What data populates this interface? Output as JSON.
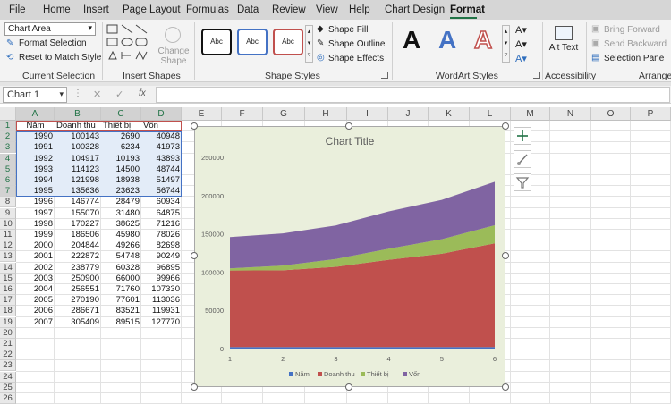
{
  "ribbon_tabs": [
    "File",
    "Home",
    "Insert",
    "Page Layout",
    "Formulas",
    "Data",
    "Review",
    "View",
    "Help",
    "Chart Design",
    "Format"
  ],
  "active_tab": "Format",
  "current_selection": {
    "dropdown_value": "Chart Area",
    "format_selection_label": "Format Selection",
    "reset_label": "Reset to Match Style",
    "group_label": "Current Selection"
  },
  "insert_shapes": {
    "change_shape_label": "Change Shape",
    "group_label": "Insert Shapes"
  },
  "shape_styles": {
    "swatch_label": "Abc",
    "fill_label": "Shape Fill",
    "outline_label": "Shape Outline",
    "effects_label": "Shape Effects",
    "group_label": "Shape Styles"
  },
  "wordart": {
    "letter": "A",
    "group_label": "WordArt Styles"
  },
  "accessibility": {
    "alt_text_label": "Alt Text",
    "group_label": "Accessibility"
  },
  "arrange": {
    "bring_forward": "Bring Forward",
    "send_backward": "Send Backward",
    "selection_pane": "Selection Pane",
    "group_label": "Arrange"
  },
  "name_box": "Chart 1",
  "fx_label": "fx",
  "columns": [
    "A",
    "B",
    "C",
    "D",
    "E",
    "F",
    "G",
    "H",
    "I",
    "J",
    "K",
    "L",
    "M",
    "N",
    "O",
    "P"
  ],
  "rows": [
    "1",
    "2",
    "3",
    "4",
    "5",
    "6",
    "7",
    "8",
    "9",
    "10",
    "11",
    "12",
    "13",
    "14",
    "15",
    "16",
    "17",
    "18",
    "19",
    "20",
    "21",
    "22",
    "23",
    "24",
    "25",
    "26"
  ],
  "table": {
    "headers": [
      "Năm",
      "Doanh thu",
      "Thiết bị",
      "Vốn"
    ],
    "rows": [
      [
        "1990",
        "100143",
        "2690",
        "40948"
      ],
      [
        "1991",
        "100328",
        "6234",
        "41973"
      ],
      [
        "1992",
        "104917",
        "10193",
        "43893"
      ],
      [
        "1993",
        "114123",
        "14500",
        "48744"
      ],
      [
        "1994",
        "121998",
        "18938",
        "51497"
      ],
      [
        "1995",
        "135636",
        "23623",
        "56744"
      ],
      [
        "1996",
        "146774",
        "28479",
        "60934"
      ],
      [
        "1997",
        "155070",
        "31480",
        "64875"
      ],
      [
        "1998",
        "170227",
        "38625",
        "71216"
      ],
      [
        "1999",
        "186506",
        "45980",
        "78026"
      ],
      [
        "2000",
        "204844",
        "49266",
        "82698"
      ],
      [
        "2001",
        "222872",
        "54748",
        "90249"
      ],
      [
        "2002",
        "238779",
        "60328",
        "96895"
      ],
      [
        "2003",
        "250900",
        "66000",
        "99966"
      ],
      [
        "2004",
        "256551",
        "71760",
        "107330"
      ],
      [
        "2005",
        "270190",
        "77601",
        "113036"
      ],
      [
        "2006",
        "286671",
        "83521",
        "119931"
      ],
      [
        "2007",
        "305409",
        "89515",
        "127770"
      ]
    ]
  },
  "chart_data": {
    "type": "area",
    "stacked": true,
    "title": "Chart Title",
    "categories": [
      "1",
      "2",
      "3",
      "4",
      "5",
      "6"
    ],
    "ylim": [
      0,
      250000
    ],
    "yticks": [
      "0",
      "50000",
      "100000",
      "150000",
      "200000",
      "250000"
    ],
    "grid": false,
    "legend_position": "bottom",
    "series": [
      {
        "name": "Năm",
        "values": [
          1990,
          1991,
          1992,
          1993,
          1994,
          1995
        ],
        "color": "#4472c4"
      },
      {
        "name": "Doanh thu",
        "values": [
          100143,
          100328,
          104917,
          114123,
          121998,
          135636
        ],
        "color": "#c0504d"
      },
      {
        "name": "Thiết bị",
        "values": [
          2690,
          6234,
          10193,
          14500,
          18938,
          23623
        ],
        "color": "#9bbb59"
      },
      {
        "name": "Vốn",
        "values": [
          40948,
          41973,
          43893,
          48744,
          51497,
          56744
        ],
        "color": "#8064a2"
      }
    ]
  }
}
